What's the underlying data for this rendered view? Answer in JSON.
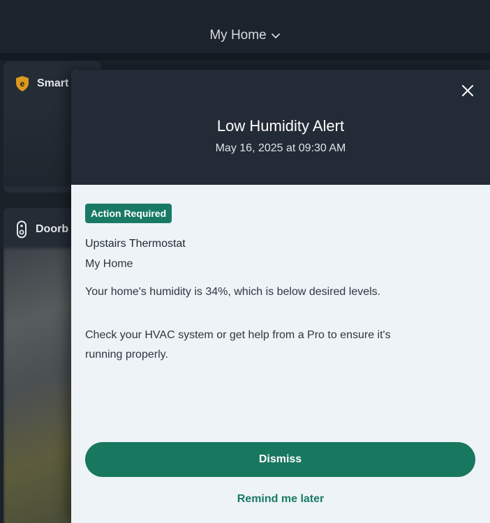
{
  "header": {
    "home_label": "My Home"
  },
  "background_cards": [
    {
      "title": "Smart",
      "icon": "shield-e-icon"
    },
    {
      "title": "Doorb",
      "icon": "doorbell-icon"
    }
  ],
  "modal": {
    "title": "Low Humidity Alert",
    "date": "May 16, 2025 at 09:30 AM",
    "badge": "Action Required",
    "device": "Upstairs Thermostat",
    "home": "My Home",
    "message": "Your home's humidity is 34%, which is below desired levels.",
    "message2": "Check your HVAC system or get help from a Pro to ensure it's running properly.",
    "dismiss_label": "Dismiss",
    "remind_label": "Remind me later"
  },
  "colors": {
    "accent": "#187a64",
    "header_bg": "#232b36",
    "body_bg": "#eef3f7",
    "badge_shield": "#d99a1f"
  }
}
